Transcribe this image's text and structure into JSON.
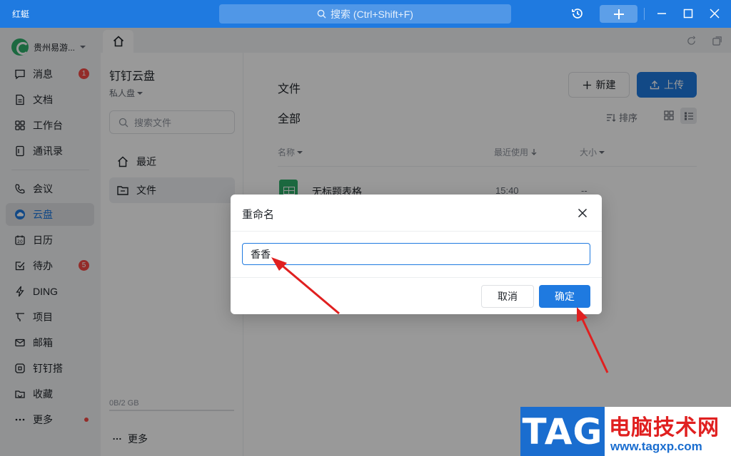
{
  "window": {
    "app_name": "红蜓",
    "search_placeholder": "搜索 (Ctrl+Shift+F)"
  },
  "org": {
    "name": "贵州易游..."
  },
  "nav": {
    "items": [
      {
        "label": "消息",
        "icon": "message-icon",
        "badge": "1"
      },
      {
        "label": "文档",
        "icon": "document-icon"
      },
      {
        "label": "工作台",
        "icon": "grid-icon"
      },
      {
        "label": "通讯录",
        "icon": "contacts-icon"
      },
      {
        "label": "会议",
        "icon": "phone-icon"
      },
      {
        "label": "云盘",
        "icon": "cloud-icon",
        "active": true
      },
      {
        "label": "日历",
        "icon": "calendar-icon"
      },
      {
        "label": "待办",
        "icon": "todo-icon",
        "badge": "5"
      },
      {
        "label": "DING",
        "icon": "lightning-icon"
      },
      {
        "label": "项目",
        "icon": "project-icon"
      },
      {
        "label": "邮箱",
        "icon": "mail-icon"
      },
      {
        "label": "钉钉搭",
        "icon": "builder-icon"
      },
      {
        "label": "收藏",
        "icon": "folder-star-icon"
      },
      {
        "label": "更多",
        "icon": "more-icon",
        "dot": true
      }
    ]
  },
  "drive": {
    "title": "钉钉云盘",
    "subtitle": "私人盘",
    "search_placeholder": "搜索文件",
    "items": [
      {
        "label": "最近",
        "icon": "home-icon"
      },
      {
        "label": "文件",
        "icon": "folder-icon",
        "active": true
      }
    ],
    "storage": "0B/2 GB",
    "more": "更多"
  },
  "main": {
    "section_title": "文件",
    "new_label": "新建",
    "upload_label": "上传",
    "subtitle": "全部",
    "sort_label": "排序",
    "columns": {
      "name": "名称",
      "recent": "最近使用",
      "size": "大小"
    },
    "files": [
      {
        "name": "无标题表格",
        "time": "15:40",
        "size": "--"
      }
    ]
  },
  "dialog": {
    "title": "重命名",
    "input_value": "香香",
    "cancel_label": "取消",
    "ok_label": "确定"
  },
  "watermark": {
    "tag": "TAG",
    "cn": "电脑技术网",
    "url": "www.tagxp.com"
  },
  "colors": {
    "accent": "#1f7ae0",
    "arrow": "#e02020",
    "badge": "#f54a45"
  }
}
